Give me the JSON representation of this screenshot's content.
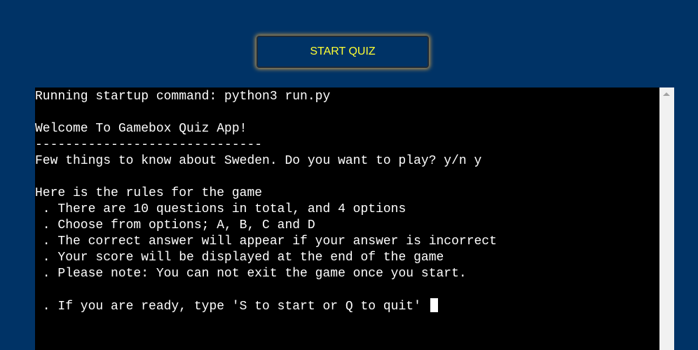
{
  "start_button": {
    "label": "START QUIZ"
  },
  "terminal": {
    "lines": [
      "Running startup command: python3 run.py",
      "",
      "Welcome To Gamebox Quiz App!",
      "------------------------------",
      "Few things to know about Sweden. Do you want to play? y/n y",
      "",
      "Here is the rules for the game",
      " . There are 10 questions in total, and 4 options",
      " . Choose from options; A, B, C and D",
      " . The correct answer will appear if your answer is incorrect",
      " . Your score will be displayed at the end of the game",
      " . Please note: You can not exit the game once you start.",
      "",
      " . If you are ready, type 'S to start or Q to quit' "
    ]
  },
  "colors": {
    "page_background": "#003366",
    "button_text": "#ffff33",
    "button_glow": "#cda050",
    "terminal_background": "#000000",
    "terminal_text": "#ffffff"
  }
}
